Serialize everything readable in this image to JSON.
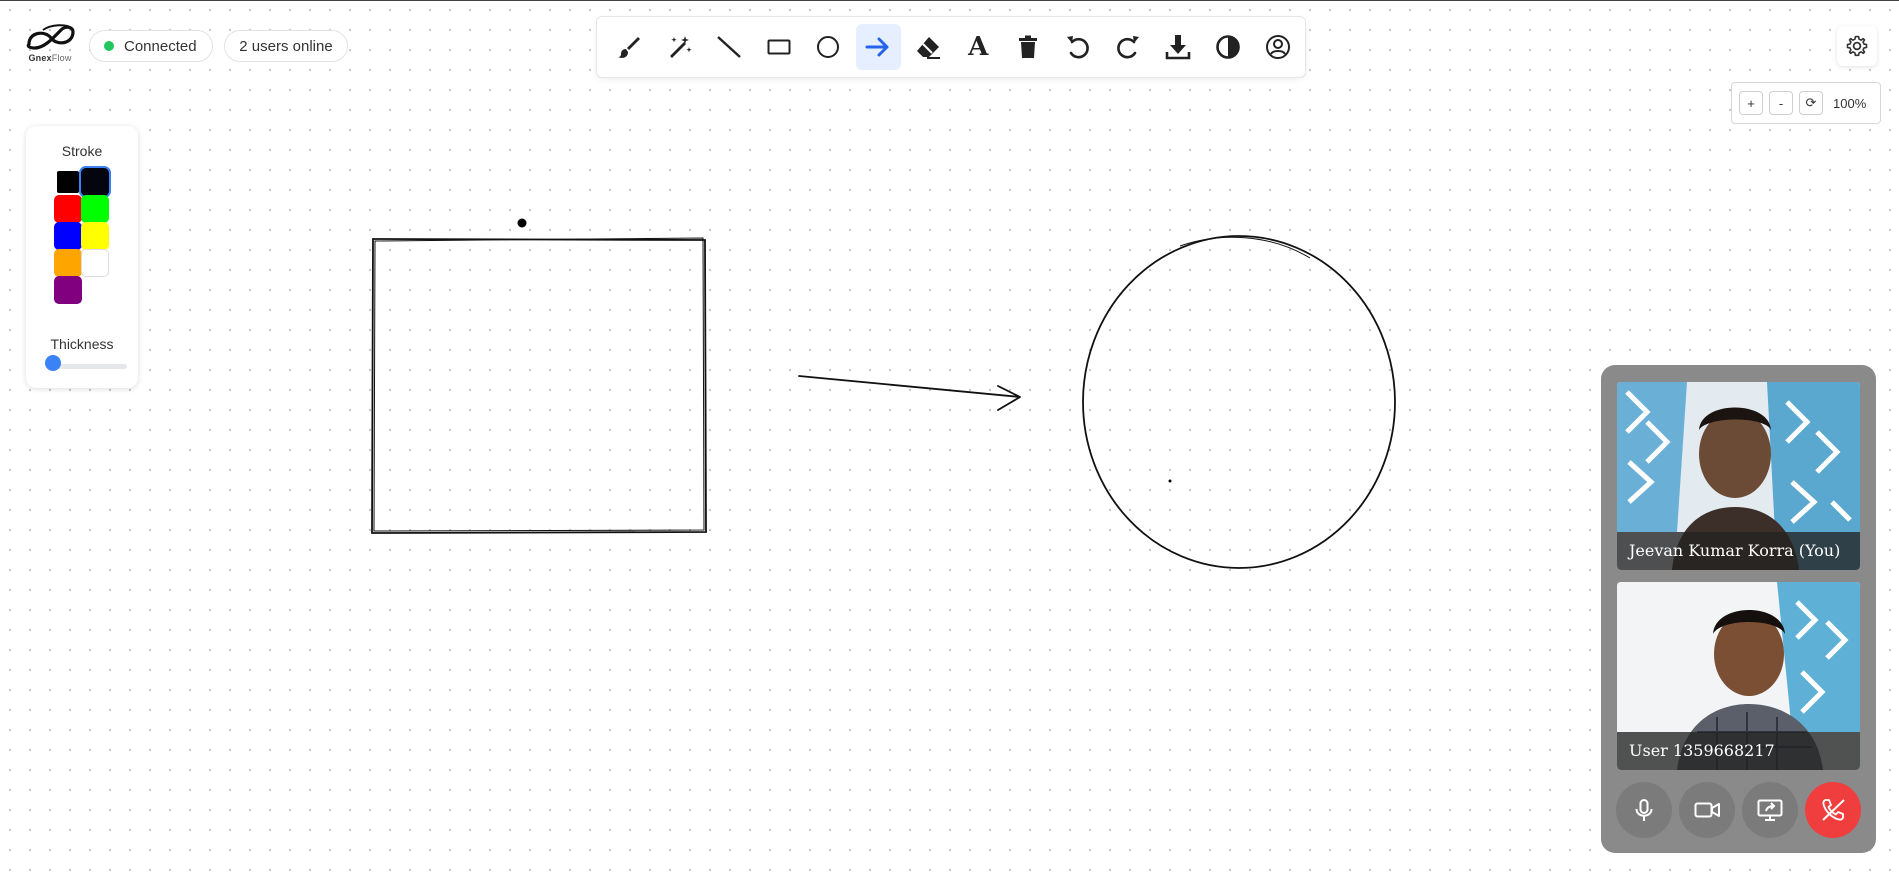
{
  "app": {
    "brand_name_bold": "Gnex",
    "brand_name_light": "Flow",
    "connection_status": "Connected",
    "users_online": "2 users online"
  },
  "toolbar": {
    "tools": [
      {
        "name": "brush",
        "icon": "brush-icon"
      },
      {
        "name": "magic",
        "icon": "magic-wand-icon"
      },
      {
        "name": "line",
        "icon": "line-icon"
      },
      {
        "name": "rectangle",
        "icon": "rectangle-icon"
      },
      {
        "name": "circle",
        "icon": "circle-icon"
      },
      {
        "name": "arrow",
        "icon": "arrow-icon",
        "active": true
      },
      {
        "name": "eraser",
        "icon": "eraser-icon"
      },
      {
        "name": "text",
        "icon": "text-icon",
        "label": "A"
      },
      {
        "name": "delete",
        "icon": "trash-icon"
      },
      {
        "name": "undo",
        "icon": "undo-icon"
      },
      {
        "name": "redo",
        "icon": "redo-icon"
      },
      {
        "name": "download",
        "icon": "download-icon"
      },
      {
        "name": "contrast",
        "icon": "contrast-icon"
      },
      {
        "name": "profile",
        "icon": "user-circle-icon"
      }
    ],
    "active_color": "#2563eb"
  },
  "zoom": {
    "zoom_in_label": "+",
    "zoom_out_label": "-",
    "reset_label": "⟳",
    "level": "100%"
  },
  "stroke_panel": {
    "stroke_label": "Stroke",
    "thickness_label": "Thickness",
    "colors": [
      {
        "name": "black",
        "hex": "#000000"
      },
      {
        "name": "dark-navy",
        "hex": "#04050f",
        "selected": true
      },
      {
        "name": "red",
        "hex": "#ff0000"
      },
      {
        "name": "green",
        "hex": "#00ff00"
      },
      {
        "name": "blue",
        "hex": "#0000ff"
      },
      {
        "name": "yellow",
        "hex": "#ffff00"
      },
      {
        "name": "orange",
        "hex": "#ffa500"
      },
      {
        "name": "white",
        "hex": "#ffffff"
      },
      {
        "name": "purple",
        "hex": "#800080"
      }
    ],
    "thickness_fraction": 0.0
  },
  "video_call": {
    "participants": [
      {
        "name": "Jeevan Kumar Korra (You)"
      },
      {
        "name": "User 1359668217"
      }
    ],
    "controls": [
      "microphone-icon",
      "camera-icon",
      "screen-share-icon",
      "end-call-icon"
    ],
    "end_call_color": "#f03e3e"
  }
}
